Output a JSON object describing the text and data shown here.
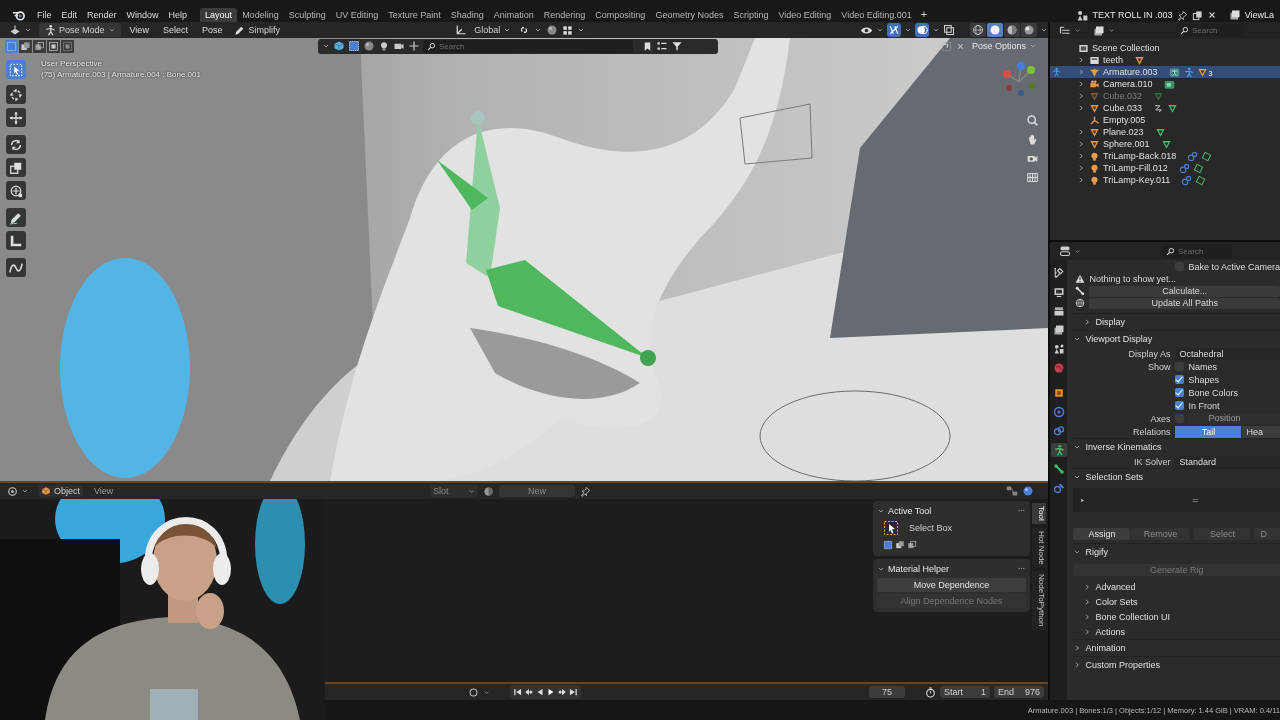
{
  "topbar": {
    "menus": [
      "File",
      "Edit",
      "Render",
      "Window",
      "Help"
    ],
    "workspaces": [
      {
        "label": "Layout",
        "selected": true
      },
      {
        "label": "Modeling",
        "selected": false
      },
      {
        "label": "Sculpting",
        "selected": false
      },
      {
        "label": "UV Editing",
        "selected": false
      },
      {
        "label": "Texture Paint",
        "selected": false
      },
      {
        "label": "Shading",
        "selected": false
      },
      {
        "label": "Animation",
        "selected": false
      },
      {
        "label": "Rendering",
        "selected": false
      },
      {
        "label": "Compositing",
        "selected": false
      },
      {
        "label": "Geometry Nodes",
        "selected": false
      },
      {
        "label": "Scripting",
        "selected": false
      },
      {
        "label": "Video Editing",
        "selected": false
      },
      {
        "label": "Video Editing.001",
        "selected": false
      }
    ],
    "add_workspace": "+",
    "scene": "TEXT ROLL IN .003",
    "view_layer": "ViewLa"
  },
  "viewport": {
    "mode": "Pose Mode",
    "menus": [
      "View",
      "Select",
      "Pose"
    ],
    "simplify": "Simplify",
    "orientation": "Global",
    "select_modes": [
      {
        "selected": true
      },
      {
        "selected": false
      },
      {
        "selected": false
      },
      {
        "selected": false
      },
      {
        "selected": false
      }
    ],
    "shading_modes": [
      {
        "kind": "wireframe",
        "selected": false
      },
      {
        "kind": "solid",
        "selected": true
      },
      {
        "kind": "material",
        "selected": false
      },
      {
        "kind": "rendered",
        "selected": false
      }
    ],
    "search": {
      "placeholder": "Search"
    },
    "pose_options": "Pose Options",
    "info": [
      "User Perspective",
      "(75) Armature.003 | Armature.004 : Bone.001"
    ],
    "tools": [
      {
        "kind": "select",
        "selected": true
      },
      {
        "kind": "cursor",
        "selected": false
      },
      {
        "kind": "move",
        "selected": false
      },
      {
        "kind": "rotate",
        "selected": false
      },
      {
        "kind": "scale",
        "selected": false
      },
      {
        "kind": "transform",
        "selected": false
      },
      {
        "kind": "annotate",
        "selected": false
      },
      {
        "kind": "measure",
        "selected": false
      },
      {
        "kind": "relax",
        "selected": false
      }
    ]
  },
  "bottom_editor": {
    "context": "Object",
    "menus": [
      "View"
    ],
    "slot": "Slot",
    "new_button": "New",
    "sidebar": {
      "panels": [
        {
          "kind": "tool",
          "title": "Active Tool",
          "expanded": true,
          "tool": "Select Box"
        },
        {
          "kind": "buttons",
          "title": "Material Helper",
          "expanded": true,
          "buttons": [
            {
              "label": "Move Dependence",
              "disabled": false
            },
            {
              "label": "Align Dependence Nodes",
              "disabled": true
            }
          ]
        }
      ],
      "tabs": [
        {
          "label": "Tool",
          "selected": true
        },
        {
          "label": "Hot Node",
          "selected": false
        },
        {
          "label": "NodeToPython",
          "selected": false
        }
      ]
    }
  },
  "timeline": {
    "current_frame": "75",
    "start_label": "Start",
    "start": "1",
    "end_label": "End",
    "end": "976"
  },
  "outliner": {
    "search": {
      "placeholder": "Search"
    },
    "root": {
      "name": "Scene Collection",
      "kind": "scene_collection",
      "selected": false,
      "hidden": false,
      "children": [
        {
          "name": "teeth",
          "kind": "collection",
          "expanded": false,
          "selected": false,
          "hidden": false,
          "badges": [
            {
              "kind": "object"
            }
          ]
        },
        {
          "name": "Armature.003",
          "kind": "armature",
          "expanded": false,
          "selected": true,
          "hidden": false,
          "active_mode": true,
          "badges": [
            {
              "kind": "pose"
            },
            {
              "kind": "armature_data"
            },
            {
              "kind": "object",
              "count": "3"
            }
          ]
        },
        {
          "name": "Camera.010",
          "kind": "camera",
          "expanded": false,
          "selected": false,
          "hidden": false,
          "badges": [
            {
              "kind": "camera_data"
            }
          ]
        },
        {
          "name": "Cube.032",
          "kind": "mesh",
          "expanded": false,
          "selected": false,
          "hidden": true,
          "badges": [
            {
              "kind": "mesh_data"
            }
          ]
        },
        {
          "name": "Cube.033",
          "kind": "mesh",
          "expanded": false,
          "selected": false,
          "hidden": false,
          "badges": [
            {
              "kind": "modifier"
            },
            {
              "kind": "mesh_data"
            }
          ]
        },
        {
          "name": "Empty.005",
          "kind": "empty",
          "selected": false,
          "hidden": false
        },
        {
          "name": "Plane.023",
          "kind": "mesh",
          "expanded": false,
          "selected": false,
          "hidden": false,
          "badges": [
            {
              "kind": "mesh_data"
            }
          ]
        },
        {
          "name": "Sphere.001",
          "kind": "mesh",
          "expanded": false,
          "selected": false,
          "hidden": false,
          "badges": [
            {
              "kind": "mesh_data"
            }
          ]
        },
        {
          "name": "TriLamp-Back.018",
          "kind": "light",
          "expanded": false,
          "selected": false,
          "hidden": false,
          "badges": [
            {
              "kind": "constraint"
            },
            {
              "kind": "light_data"
            }
          ]
        },
        {
          "name": "TriLamp-Fill.012",
          "kind": "light",
          "expanded": false,
          "selected": false,
          "hidden": false,
          "badges": [
            {
              "kind": "constraint"
            },
            {
              "kind": "light_data"
            }
          ]
        },
        {
          "name": "TriLamp-Key.011",
          "kind": "light",
          "expanded": false,
          "selected": false,
          "hidden": false,
          "badges": [
            {
              "kind": "constraint"
            },
            {
              "kind": "light_data"
            }
          ]
        }
      ]
    }
  },
  "properties": {
    "search": {
      "placeholder": "Search"
    },
    "tabs": [
      {
        "kind": "tool",
        "selected": false
      },
      {
        "kind": "render",
        "selected": false
      },
      {
        "kind": "output",
        "selected": false
      },
      {
        "kind": "view_layer",
        "selected": false
      },
      {
        "kind": "scene",
        "selected": false
      },
      {
        "kind": "world",
        "selected": false
      },
      {
        "kind": "object",
        "selected": false
      },
      {
        "kind": "physics",
        "selected": false
      },
      {
        "kind": "constraints",
        "selected": false
      },
      {
        "kind": "armature",
        "selected": true
      },
      {
        "kind": "bone",
        "selected": false
      },
      {
        "kind": "bone_constraint",
        "selected": false
      }
    ],
    "motion_paths": {
      "bake": {
        "label": "Bake to Active Camera",
        "checked": false
      },
      "message": "Nothing to show yet...",
      "calculate": "Calculate...",
      "update": "Update All Paths"
    },
    "panels": [
      {
        "title": "Display",
        "expanded": false,
        "sub": true
      },
      {
        "title": "Viewport Display",
        "expanded": true,
        "rows": [
          {
            "kind": "dropdown",
            "label": "Display As",
            "value": "Octahedral"
          },
          {
            "kind": "checkbox",
            "label": "Show",
            "text": "Names",
            "checked": false
          },
          {
            "kind": "checkbox",
            "text": "Shapes",
            "checked": true
          },
          {
            "kind": "checkbox",
            "text": "Bone Colors",
            "checked": true
          },
          {
            "kind": "checkbox",
            "text": "In Front",
            "checked": true
          },
          {
            "kind": "check_field",
            "label": "Axes",
            "checked": false,
            "value": "Position",
            "disabled": true
          },
          {
            "kind": "segmented",
            "label": "Relations",
            "options": [
              {
                "label": "Tail",
                "selected": true
              },
              {
                "label": "Hea",
                "selected": false
              }
            ]
          }
        ]
      },
      {
        "title": "Inverse Kinematics",
        "expanded": true,
        "rows": [
          {
            "kind": "dropdown",
            "label": "IK Solver",
            "value": "Standard"
          }
        ]
      },
      {
        "title": "Selection Sets",
        "expanded": true,
        "rows": [
          {
            "kind": "list"
          },
          {
            "kind": "buttons",
            "buttons": [
              {
                "label": "Assign",
                "disabled": false
              },
              {
                "label": "Remove",
                "disabled": true
              },
              {
                "label": "Select",
                "disabled": true
              },
              {
                "label": "D",
                "disabled": true
              }
            ]
          }
        ]
      },
      {
        "title": "Rigify",
        "expanded": true,
        "rows": [
          {
            "kind": "button",
            "label": "Generate Rig",
            "disabled": true
          },
          {
            "kind": "subpanel",
            "title": "Advanced",
            "expanded": false
          },
          {
            "kind": "subpanel",
            "title": "Color Sets",
            "expanded": false
          },
          {
            "kind": "subpanel",
            "title": "Bone Collection UI",
            "expanded": false
          },
          {
            "kind": "subpanel",
            "title": "Actions",
            "expanded": false
          }
        ]
      },
      {
        "title": "Animation",
        "expanded": false
      },
      {
        "title": "Custom Properties",
        "expanded": false
      }
    ]
  },
  "status_bar": {
    "text": "Armature.003 | Bones:1/3 | Objects:1/12 | Memory: 1.44 GiB | VRAM: 0.4/11"
  }
}
